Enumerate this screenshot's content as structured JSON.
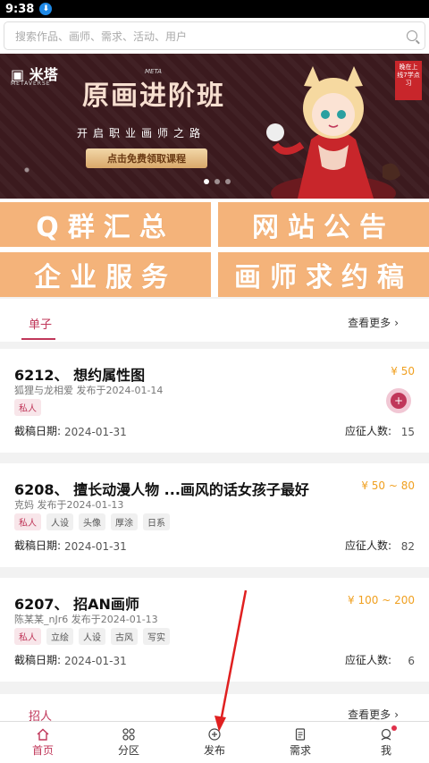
{
  "status": {
    "time": "9:38"
  },
  "search": {
    "placeholder": "搜索作品、画师、需求、活动、用户"
  },
  "banner": {
    "logo": "米塔",
    "logo_sub": "METAVERSE",
    "meta_tag": "META",
    "title": "原画进阶班",
    "subtitle": "开启职业画师之路",
    "cta": "点击免费领取课程",
    "badge": "晚在上线7学点习"
  },
  "tiles": [
    "Q群汇总",
    "网站公告",
    "企业服务",
    "画师求约稿"
  ],
  "orders_section": {
    "tab": "单子",
    "more": "查看更多"
  },
  "orders": [
    {
      "title": "6212、 想约属性图",
      "meta": "狐狸与龙相爱 发布于2024-01-14",
      "price": "¥ 50",
      "tags": [
        "私人"
      ],
      "due_label": "截稿日期:",
      "due": "2024-01-31",
      "count_label": "应征人数:",
      "count": "15"
    },
    {
      "title": "6208、 擅长动漫人物 ...画风的话女孩子最好",
      "meta": "克妈 发布于2024-01-13",
      "price": "¥ 50 ~ 80",
      "tags": [
        "私人",
        "人设",
        "头像",
        "厚涂",
        "日系"
      ],
      "due_label": "截稿日期:",
      "due": "2024-01-31",
      "count_label": "应征人数:",
      "count": "82"
    },
    {
      "title": "6207、 招AN画师",
      "meta": "陈某某_nJr6 发布于2024-01-13",
      "price": "¥ 100 ~ 200",
      "tags": [
        "私人",
        "立绘",
        "人设",
        "古风",
        "写实"
      ],
      "due_label": "截稿日期:",
      "due": "2024-01-31",
      "count_label": "应征人数:",
      "count": "6"
    }
  ],
  "recruit_section": {
    "tab": "招人",
    "more": "查看更多"
  },
  "nav": [
    "首页",
    "分区",
    "发布",
    "需求",
    "我"
  ],
  "colors": {
    "accent": "#c0375a",
    "tile": "#f4b37a",
    "price": "#f0a020"
  }
}
